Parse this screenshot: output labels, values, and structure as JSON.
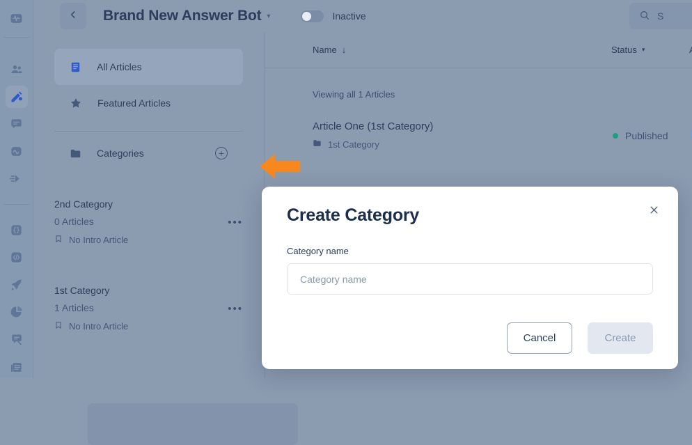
{
  "rail": {
    "items": [
      {
        "icon": "activity-monitor-icon",
        "active": false,
        "accent": false
      },
      {
        "icon": "people-icon",
        "active": false,
        "accent": false
      },
      {
        "icon": "edit-pencil-icon",
        "active": true,
        "accent": true
      },
      {
        "icon": "chat-bubble-icon",
        "active": false,
        "accent": false
      },
      {
        "icon": "waveform-box-icon",
        "active": false,
        "accent": false
      },
      {
        "icon": "send-arrow-icon",
        "active": false,
        "accent": false
      },
      {
        "icon": "curly-braces-icon",
        "active": false,
        "accent": false
      },
      {
        "icon": "code-brackets-icon",
        "active": false,
        "accent": false
      },
      {
        "icon": "rocket-icon",
        "active": false,
        "accent": false
      },
      {
        "icon": "pie-chart-icon",
        "active": false,
        "accent": false
      },
      {
        "icon": "chat-search-icon",
        "active": false,
        "accent": false
      },
      {
        "icon": "article-icon",
        "active": false,
        "accent": false
      }
    ]
  },
  "header": {
    "back_icon": "chevron-left-icon",
    "title": "Brand New Answer Bot",
    "title_caret": "▾",
    "toggle_state": "off",
    "toggle_label": "Inactive",
    "search_icon": "search-icon",
    "search_text": "S"
  },
  "sidebar": {
    "nav": [
      {
        "label": "All Articles",
        "icon": "document-icon",
        "selected": true
      },
      {
        "label": "Featured Articles",
        "icon": "star-icon",
        "selected": false
      }
    ],
    "categories_header": {
      "label": "Categories",
      "icon": "folder-icon",
      "add_icon": "plus-circle-icon"
    },
    "categories": [
      {
        "name": "2nd Category",
        "count": "0 Articles",
        "intro": "No Intro Article",
        "intro_icon": "bookmark-icon",
        "menu_icon": "ellipsis-icon"
      },
      {
        "name": "1st Category",
        "count": "1 Articles",
        "intro": "No Intro Article",
        "intro_icon": "bookmark-icon",
        "menu_icon": "ellipsis-icon"
      }
    ]
  },
  "table": {
    "columns": {
      "name": "Name",
      "name_sort": "↓",
      "status": "Status",
      "status_caret": "▾",
      "third": "A"
    },
    "viewing": "Viewing all 1 Articles",
    "rows": [
      {
        "title": "Article One (1st Category)",
        "category": "1st Category",
        "category_icon": "folder-icon",
        "status": "Published",
        "status_color": "#1f9e86"
      }
    ]
  },
  "annotation": {
    "arrow_icon": "left-arrow-annotation",
    "arrow_color": "#f7881f"
  },
  "modal": {
    "title": "Create Category",
    "close_icon": "close-icon",
    "field_label": "Category name",
    "input_value": "",
    "input_placeholder": "Category name",
    "cancel_label": "Cancel",
    "create_label": "Create"
  },
  "colors": {
    "overlay": "#8b9bb0",
    "accent_blue": "#2f5bd0",
    "status_green": "#1f9e86",
    "annotation_orange": "#f7881f",
    "modal_bg": "#ffffff"
  }
}
